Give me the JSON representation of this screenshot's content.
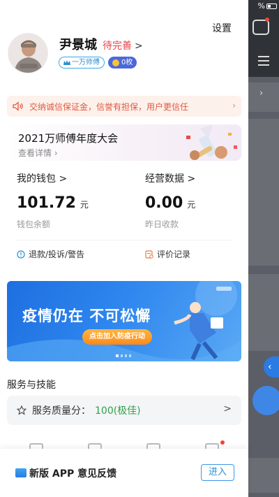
{
  "status_bar": {
    "battery_text": "%"
  },
  "drawer": {
    "settings_label": "设置",
    "profile": {
      "name": "尹景城",
      "pending_label": "待完善",
      "pending_chevron": ">",
      "rank_badge": "一万师傅",
      "coin_badge": "0枚"
    },
    "notice": {
      "text": "交纳诚信保证金，信誉有担保，用户更信任",
      "chevron": "›"
    },
    "conference": {
      "title": "2021万师傅年度大会",
      "subtitle": "查看详情 ›"
    },
    "wallet": {
      "label": "我的钱包 >",
      "value": "101.72",
      "unit": "元",
      "sub": "钱包余额"
    },
    "business": {
      "label": "经营数据 >",
      "value": "0.00",
      "unit": "元",
      "sub": "昨日收款"
    },
    "links": {
      "refund": "退款/投诉/警告",
      "reviews": "评价记录"
    },
    "banner": {
      "title": "疫情仍在  不可松懈",
      "cta": "点击加入防疫行动",
      "slide_count": 4,
      "active_slide": 1
    },
    "services": {
      "section_title": "服务与技能",
      "score_label": "服务质量分：",
      "score_value": "100(极佳)",
      "chevron": ">"
    },
    "feedback": {
      "text": "新版 APP 意见反馈",
      "button": "进入"
    }
  },
  "colors": {
    "accent_red": "#e9444d",
    "accent_blue": "#2b8fd0",
    "notice_text": "#e05a3f",
    "score_green": "#2fa24a",
    "banner_blue": "#1e6fe0"
  }
}
